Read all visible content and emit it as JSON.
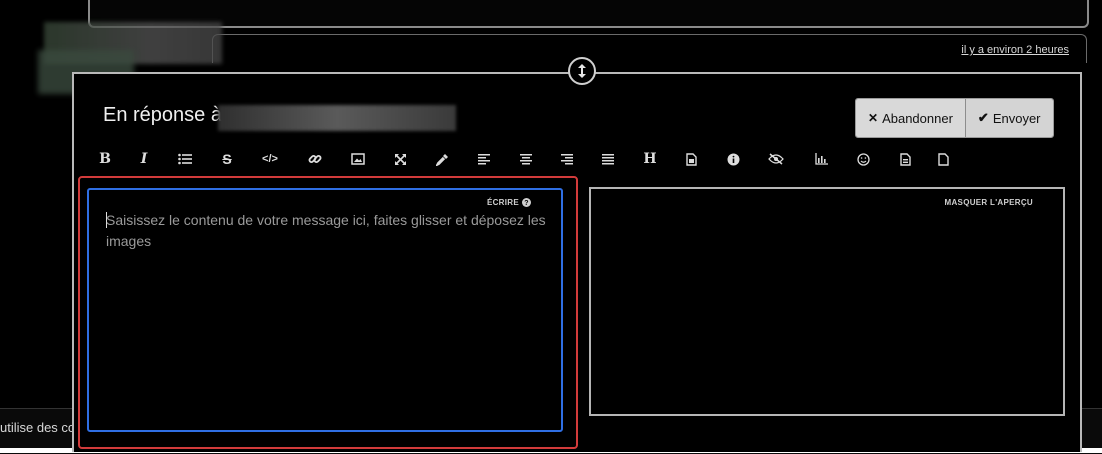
{
  "post": {
    "timestamp": "il y a environ 2 heures"
  },
  "footer": {
    "cookie_text": "utilise des co"
  },
  "composer": {
    "reply_prefix": "En réponse à",
    "cancel_label": "Abandonner",
    "send_label": "Envoyer",
    "editor_mode_label": "ÉCRIRE",
    "placeholder": "Saisissez le contenu de votre message ici, faites glisser et déposez les images",
    "preview_toggle_label": "MASQUER L'APERÇU"
  },
  "toolbar": {
    "tools": [
      {
        "name": "bold",
        "glyph": "B"
      },
      {
        "name": "italic",
        "glyph": "I"
      },
      {
        "name": "bullet-list",
        "glyph": "≡"
      },
      {
        "name": "strikethrough",
        "glyph": "S"
      },
      {
        "name": "code",
        "glyph": "</>"
      },
      {
        "name": "link",
        "glyph": "🔗"
      },
      {
        "name": "image",
        "glyph": "▣"
      },
      {
        "name": "fullscreen",
        "glyph": "⤢"
      },
      {
        "name": "color-picker",
        "glyph": "✎"
      },
      {
        "name": "align-left",
        "glyph": "≡"
      },
      {
        "name": "align-center",
        "glyph": "≡"
      },
      {
        "name": "align-right",
        "glyph": "≡"
      },
      {
        "name": "justify",
        "glyph": "≡"
      },
      {
        "name": "heading",
        "glyph": "H"
      },
      {
        "name": "file",
        "glyph": "▤"
      },
      {
        "name": "info",
        "glyph": "i"
      },
      {
        "name": "spoiler",
        "glyph": "◌"
      },
      {
        "name": "chart",
        "glyph": "▥"
      },
      {
        "name": "emoji",
        "glyph": "☺"
      },
      {
        "name": "template",
        "glyph": "▤"
      },
      {
        "name": "page",
        "glyph": "▢"
      }
    ]
  },
  "colors": {
    "editor_focus_border": "#2f6fe4",
    "highlight_ring": "#d23b3b",
    "button_bg": "#d9d9d9"
  }
}
